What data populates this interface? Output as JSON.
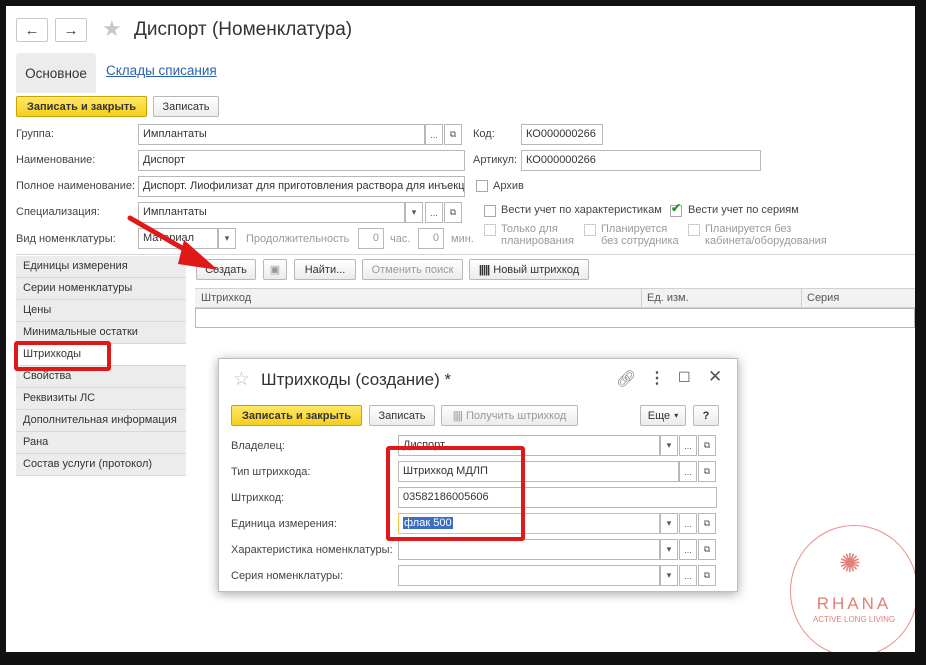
{
  "window": {
    "title": "Диспорт (Номенклатура)",
    "back_icon": "←",
    "forward_icon": "→"
  },
  "tabs": {
    "main": "Основное",
    "warehouses": "Склады списания"
  },
  "toolbar": {
    "save_close": "Записать и закрыть",
    "save": "Записать"
  },
  "form": {
    "group_label": "Группа:",
    "group_value": "Имплантаты",
    "code_label": "Код:",
    "code_value": "КО000000266",
    "name_label": "Наименование:",
    "name_value": "Диспорт",
    "article_label": "Артикул:",
    "article_value": "КО000000266",
    "fullname_label": "Полное наименование:",
    "fullname_value": "Диспорт. Лиофилизат для приготовления раствора для инъекц",
    "archive_label": "Архив",
    "spec_label": "Специализация:",
    "spec_value": "Имплантаты",
    "track_char_label": "Вести учет по характеристикам",
    "track_series_label": "Вести учет по сериям",
    "kind_label": "Вид номенклатуры:",
    "kind_value": "Материал",
    "duration_label": "Продолжительность",
    "hours_value": "0",
    "hours_label": "час.",
    "minutes_value": "0",
    "minutes_label": "мин.",
    "planning_only_label": "Только для планирования",
    "planned_no_staff_label": "Планируется без сотрудника",
    "planned_no_cabinet_label": "Планируется без кабинета/оборудования",
    "ellipsis": "...",
    "dropdown": "▾",
    "open": "⧉"
  },
  "sidebar": {
    "items": [
      "Единицы измерения",
      "Серии номенклатуры",
      "Цены",
      "Минимальные остатки",
      "Штрихкоды",
      "Свойства",
      "Реквизиты ЛС",
      "Дополнительная информация",
      "Рана",
      "Состав услуги (протокол)"
    ]
  },
  "barcode_toolbar": {
    "create": "Создать",
    "find": "Найти...",
    "cancel_search": "Отменить поиск",
    "new_barcode": "Новый штрихкод"
  },
  "grid": {
    "columns": [
      "Штрихкод",
      "Ед. изм.",
      "Серия"
    ]
  },
  "dialog": {
    "title": "Штрихкоды (создание) *",
    "save_close": "Записать и закрыть",
    "save": "Записать",
    "get_barcode": "Получить штрихкод",
    "more": "Еще",
    "help": "?",
    "owner_label": "Владелец:",
    "owner_value": "Диспорт",
    "type_label": "Тип штрихкода:",
    "type_value": "Штрихкод МДЛП",
    "barcode_label": "Штрихкод:",
    "barcode_value": "03582186005606",
    "unit_label": "Единица измерения:",
    "unit_value": "флак 500",
    "char_label": "Характеристика номенклатуры:",
    "char_value": "",
    "series_label": "Серия номенклатуры:",
    "series_value": ""
  },
  "watermark": {
    "name": "RHANA",
    "tagline": "ACTIVE LONG LIVING"
  },
  "colors": {
    "accent_yellow": "#f5cf1f",
    "link": "#2a62b0",
    "highlight_red": "#e01818"
  }
}
